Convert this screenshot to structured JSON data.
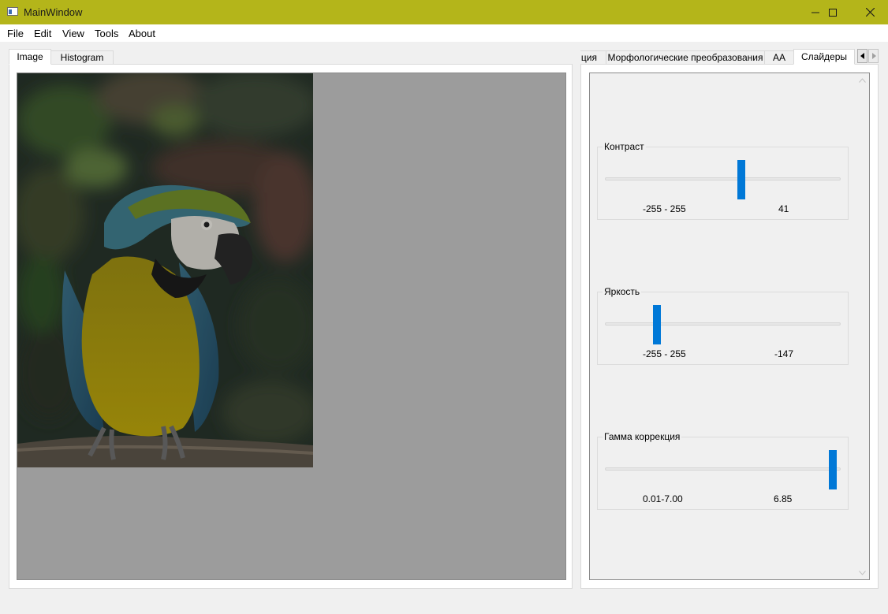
{
  "window": {
    "title": "MainWindow",
    "title_bar_color": "#b4b51a",
    "controls": [
      "minimize-icon",
      "maximize-icon",
      "close-icon"
    ]
  },
  "menu": {
    "items": [
      "File",
      "Edit",
      "View",
      "Tools",
      "About"
    ]
  },
  "left_tabs": {
    "items": [
      "Image",
      "Histogram"
    ],
    "active": "Image"
  },
  "right_tabs": {
    "items": [
      "…ция",
      "Морфологические преобразования",
      "AA",
      "Слайдеры"
    ],
    "active": "Слайдеры",
    "scroll_buttons": [
      "chevron-left-icon",
      "chevron-right-icon"
    ]
  },
  "sliders": [
    {
      "title": "Контраст",
      "range": "-255 - 255",
      "value": "41",
      "min": -255,
      "max": 255,
      "current": 41
    },
    {
      "title": "Яркость",
      "range": "-255 - 255",
      "value": "-147",
      "min": -255,
      "max": 255,
      "current": -147
    },
    {
      "title": "Гамма коррекция",
      "range": "0.01-7.00",
      "value": "6.85",
      "min": 0.01,
      "max": 7.0,
      "current": 6.85
    }
  ],
  "colors": {
    "accent": "#0078d7",
    "image_area_bg": "#9c9c9c"
  }
}
